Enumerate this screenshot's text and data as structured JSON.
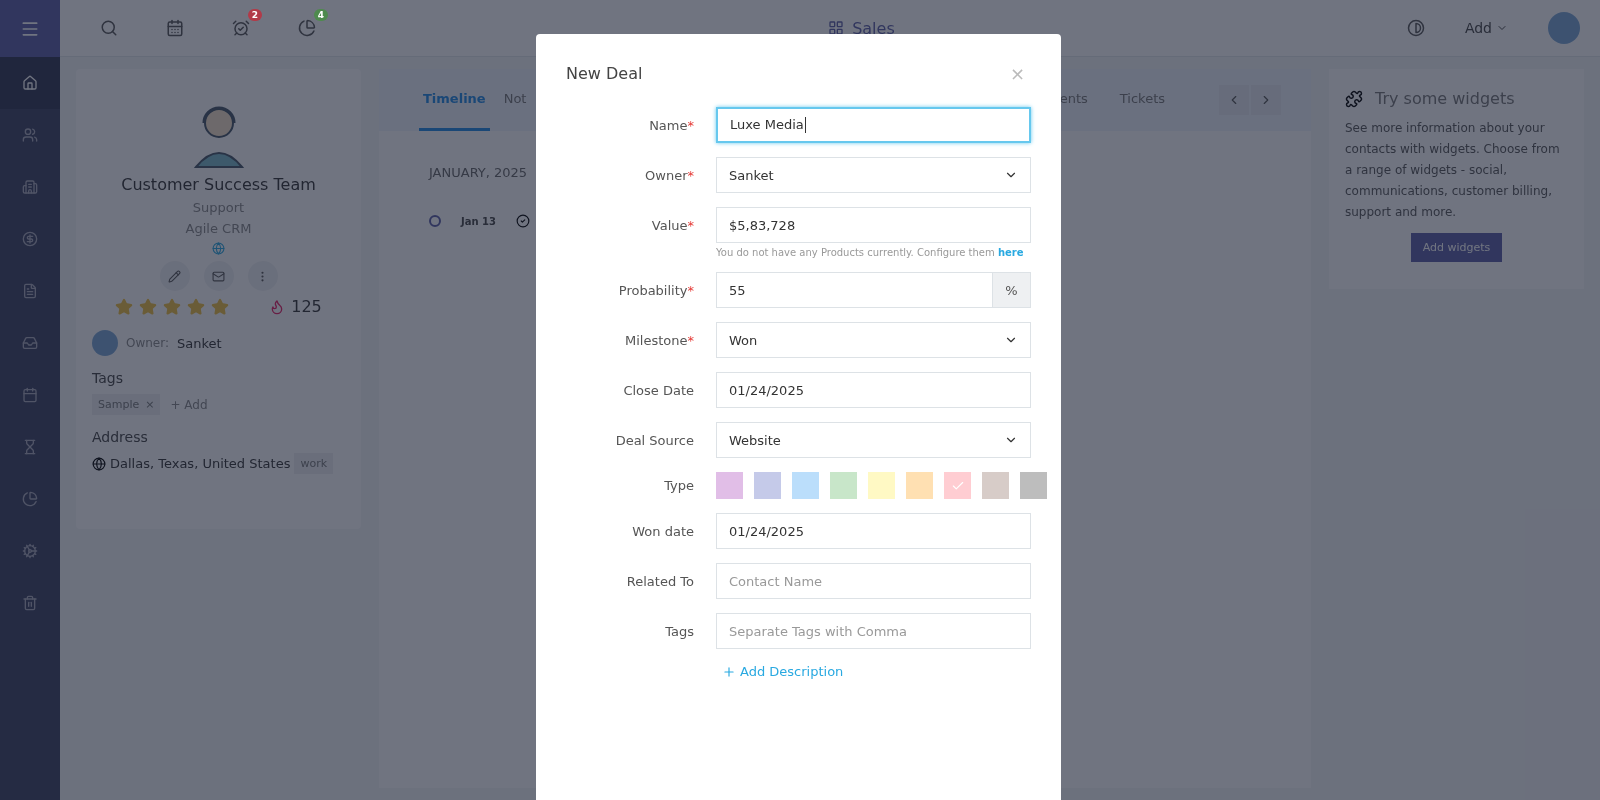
{
  "topbar": {
    "icons": [
      {
        "kind": "search"
      },
      {
        "kind": "calendar"
      },
      {
        "kind": "alarm",
        "badge": "2",
        "color": "#b23a48"
      },
      {
        "kind": "pie",
        "badge": "4",
        "color": "#4e8a4e"
      }
    ],
    "title": "Sales",
    "add": "Add"
  },
  "sidebar": {
    "items": [
      {
        "kind": "home",
        "selected": true
      },
      {
        "kind": "users",
        "selected": false
      },
      {
        "kind": "building",
        "selected": false
      },
      {
        "kind": "dollar",
        "selected": false
      },
      {
        "kind": "file",
        "selected": false
      },
      {
        "kind": "inbox",
        "selected": false
      },
      {
        "kind": "calendar",
        "selected": false
      },
      {
        "kind": "hourglass",
        "selected": false
      },
      {
        "kind": "pie",
        "selected": false
      },
      {
        "kind": "cogs",
        "selected": false
      },
      {
        "kind": "trash",
        "selected": false
      }
    ]
  },
  "contact": {
    "name": "Customer Success Team",
    "role": "Support",
    "company": "Agile CRM",
    "stars": 5,
    "score": "125",
    "owner_label": "Owner:",
    "owner": "Sanket",
    "tags_heading": "Tags",
    "tags": [
      "Sample"
    ],
    "tag_remove": "×",
    "add_tag": "+ Add",
    "address_heading": "Address",
    "address": "Dallas, Texas, United States",
    "address_type": "work"
  },
  "tabs": {
    "before_dialog": [
      {
        "label": "Timeline",
        "selected": true
      },
      {
        "label": "Not",
        "selected": false
      }
    ],
    "after_dialog": [
      {
        "label": "ents",
        "selected": false
      },
      {
        "label": "Tickets",
        "selected": false
      }
    ]
  },
  "timeline": {
    "month": "JANUARY, 2025",
    "entries": [
      {
        "date": "Jan 13"
      }
    ]
  },
  "widgets": {
    "title": "Try some widgets",
    "text": "See more information about your contacts with widgets. Choose from a range of widgets - social, communications, customer billing, support and more.",
    "button": "Add widgets"
  },
  "modal": {
    "title": "New Deal",
    "close": "×",
    "required_mark": "*",
    "fields": [
      {
        "label": "Name",
        "required": true,
        "kind": "text",
        "value": "Luxe Media",
        "focused": true
      },
      {
        "label": "Owner",
        "required": true,
        "kind": "select",
        "value": "Sanket",
        "focused": false
      },
      {
        "label": "Value",
        "required": true,
        "kind": "text",
        "value": "$5,83,728",
        "focused": false,
        "help": "You do not have any Products currently. Configure them",
        "help_link": "here"
      },
      {
        "label": "Probability",
        "required": true,
        "kind": "addon",
        "value": "55",
        "addon": "%",
        "focused": false
      },
      {
        "label": "Milestone",
        "required": true,
        "kind": "select",
        "value": "Won",
        "focused": false
      },
      {
        "label": "Close Date",
        "required": false,
        "kind": "text",
        "value": "01/24/2025",
        "focused": false
      },
      {
        "label": "Deal Source",
        "required": false,
        "kind": "select",
        "value": "Website",
        "focused": false
      },
      {
        "label": "Type",
        "required": false,
        "kind": "swatches",
        "swatches": [
          {
            "color": "#e1bee7",
            "selected": false
          },
          {
            "color": "#c5cae9",
            "selected": false
          },
          {
            "color": "#bbdefb",
            "selected": false
          },
          {
            "color": "#c8e6c9",
            "selected": false
          },
          {
            "color": "#fff9c4",
            "selected": false
          },
          {
            "color": "#ffe0b2",
            "selected": false
          },
          {
            "color": "#ffcdd2",
            "selected": true
          },
          {
            "color": "#d7ccc8",
            "selected": false
          },
          {
            "color": "#bdbdbd",
            "selected": false
          }
        ]
      },
      {
        "label": "Won date",
        "required": false,
        "kind": "text",
        "value": "01/24/2025",
        "focused": false
      },
      {
        "label": "Related To",
        "required": false,
        "kind": "text",
        "placeholder": "Contact Name",
        "focused": false
      },
      {
        "label": "Tags",
        "required": false,
        "kind": "text",
        "placeholder": "Separate Tags with Comma",
        "focused": false
      }
    ],
    "add_description": "Add Description"
  }
}
